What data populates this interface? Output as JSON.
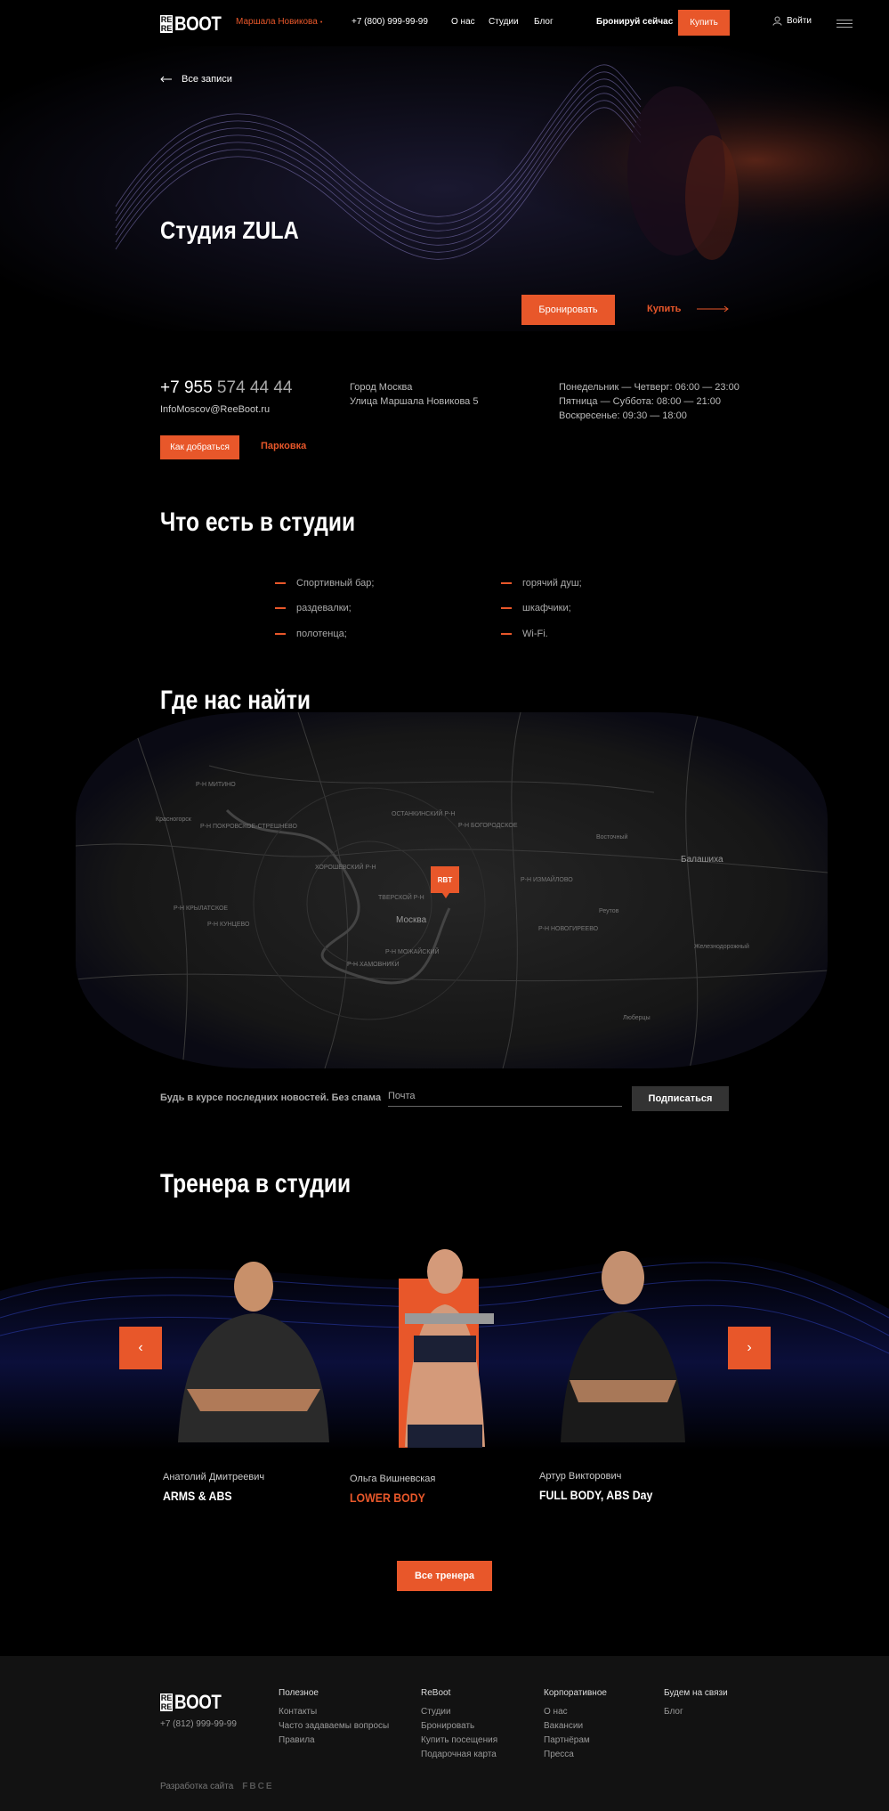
{
  "header": {
    "location": "Маршала Новикова",
    "phone": "+7 (800) 999-99-99",
    "nav": [
      "О нас",
      "Студии",
      "Блог"
    ],
    "book_now": "Бронируй сейчас",
    "buy": "Купить",
    "login": "Войти"
  },
  "hero": {
    "back_label": "Все записи",
    "title": "Студия ZULA",
    "book_button": "Бронировать",
    "buy_link": "Купить"
  },
  "contacts": {
    "phone_prefix": "+7 955 ",
    "phone_rest": "574 44 44",
    "email": "InfoMoscov@ReeBoot.ru",
    "route_button": "Как добраться",
    "parking": "Парковка",
    "city": "Город Москва",
    "street": "Улица Маршала Новикова 5",
    "hours": [
      "Понедельник — Четверг: 06:00 — 23:00",
      "Пятница — Суббота: 08:00 — 21:00",
      "Воскресенье: 09:30 — 18:00"
    ]
  },
  "amenities": {
    "title": "Что есть в студии",
    "items": [
      "Спортивный бар;",
      "горячий душ;",
      "раздевалки;",
      "шкафчики;",
      "полотенца;",
      "Wi-Fi."
    ]
  },
  "map": {
    "title": "Где нас найти",
    "city_label": "Москва",
    "pin_label": "RBT",
    "labels": [
      "Красногорск",
      "Р-Н КРЫЛАТСКОЕ",
      "Р-Н КУНЦЕВО",
      "ХОРОШЕВСКИЙ Р-Н",
      "ТВЕРСКОЙ Р-Н",
      "Р-Н ХАМОВНИКИ",
      "Р-Н ИЗМАЙЛОВО",
      "Балашиха",
      "Реутов",
      "Люберцы",
      "Восточный",
      "ОСТАНКИНСКИЙ Р-Н",
      "Р-Н БОГОРОДСКОЕ",
      "Р-Н ПОКРОВСКОЕ-СТРЕШНЕВО",
      "Р-Н МИТИНО",
      "Р-Н НОВОГИРЕЕВО",
      "Р-Н МОЖАЙСКИЙ",
      "Железнодорожный"
    ]
  },
  "subscribe": {
    "text": "Будь в курсе последних новостей. Без спама",
    "placeholder": "Почта",
    "button": "Подписаться"
  },
  "trainers": {
    "title": "Тренера в студии",
    "prev": "‹",
    "next": "›",
    "list": [
      {
        "name": "Анатолий Дмитреевич",
        "spec": "ARMS & ABS"
      },
      {
        "name": "Ольга Вишневская",
        "spec": "LOWER BODY"
      },
      {
        "name": "Артур Викторович",
        "spec": "FULL BODY, ABS Day"
      }
    ],
    "all_button": "Все тренера"
  },
  "footer": {
    "phone": "+7 (812) 999-99-99",
    "columns": [
      {
        "title": "Полезное",
        "items": [
          "Контакты",
          "Часто задаваемы вопросы",
          "Правила"
        ]
      },
      {
        "title": "ReBoot",
        "items": [
          "Студии",
          "Бронировать",
          "Купить посещения",
          "Подарочная карта"
        ]
      },
      {
        "title": "Корпоративное",
        "items": [
          "О нас",
          "Вакансии",
          "Партнёрам",
          "Пресса"
        ]
      },
      {
        "title": "Будем на связи",
        "items": [
          "Блог"
        ]
      }
    ],
    "developer": "Разработка сайта",
    "developer_logo": "FBCE"
  },
  "colors": {
    "accent": "#e8572a",
    "background": "#000000",
    "footer": "#121212"
  }
}
